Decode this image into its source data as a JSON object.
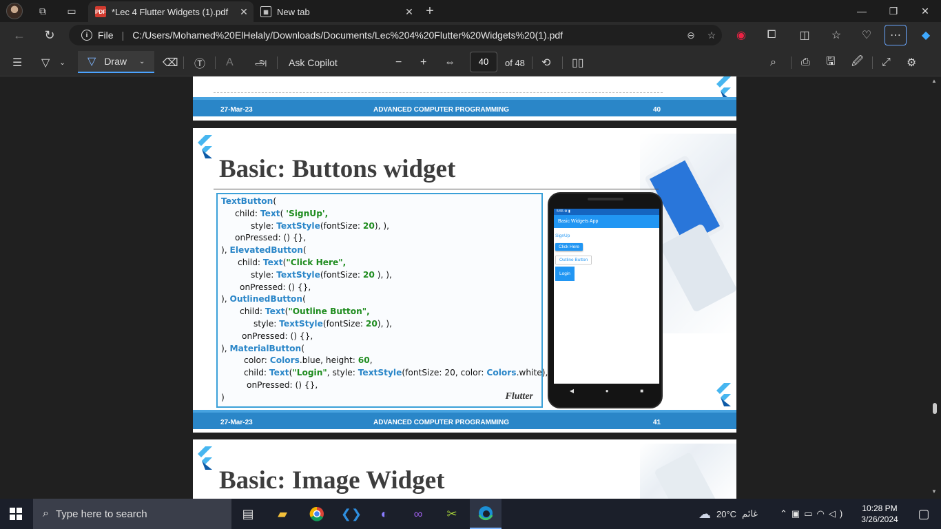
{
  "browser": {
    "tabs": [
      {
        "title": "*Lec 4 Flutter Widgets (1).pdf",
        "icon": "PDF",
        "active": true
      },
      {
        "title": "New tab",
        "active": false
      }
    ],
    "address": {
      "scheme_label": "File",
      "url": "C:/Users/Mohamed%20ElHelaly/Downloads/Documents/Lec%204%20Flutter%20Widgets%20(1).pdf"
    }
  },
  "pdf_toolbar": {
    "draw_label": "Draw",
    "copilot_label": "Ask Copilot",
    "current_page": "40",
    "page_total": "of 48"
  },
  "document": {
    "prev_footer": {
      "date": "27-Mar-23",
      "title": "ADVANCED COMPUTER PROGRAMMING",
      "page": "40"
    },
    "slide": {
      "title": "Basic: Buttons widget",
      "caption": "Flutter",
      "footer": {
        "date": "27-Mar-23",
        "title": "ADVANCED COMPUTER PROGRAMMING",
        "page": "41"
      },
      "phone": {
        "status": "5:55 ⚙ ▮",
        "app_title": "Basic Widgets App",
        "text_button": "SignUp",
        "elevated_button": "Click Here",
        "outlined_button": "Outline Button",
        "material_button": "Login"
      }
    },
    "next_slide": {
      "title": "Basic: Image Widget"
    }
  },
  "taskbar": {
    "search_placeholder": "Type here to search",
    "weather": "20°C",
    "weather_desc": "غائم",
    "time": "10:28 PM",
    "date": "3/26/2024"
  }
}
